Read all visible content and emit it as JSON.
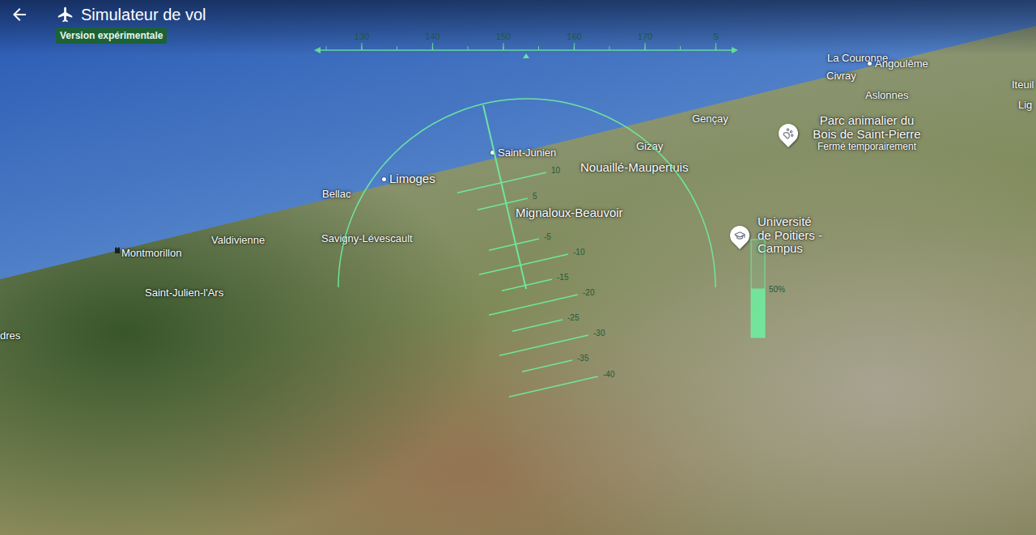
{
  "header": {
    "title": "Simulateur de vol",
    "badge": "Version expérimentale"
  },
  "heading_tape": {
    "labels": [
      "130",
      "140",
      "150",
      "160",
      "170",
      "S"
    ]
  },
  "pitch_ladder": {
    "labels": [
      "10",
      "5",
      "-5",
      "-10",
      "-15",
      "-20",
      "-25",
      "-30",
      "-35",
      "-40"
    ]
  },
  "throttle": {
    "reading": "50%",
    "level": 0.5
  },
  "places": [
    {
      "name": "La Couronne",
      "kind": "plain"
    },
    {
      "name": "Angoulême",
      "kind": "dot"
    },
    {
      "name": "Civray",
      "kind": "plain"
    },
    {
      "name": "Aslonnes",
      "kind": "plain"
    },
    {
      "name": "Iteuil",
      "kind": "plain"
    },
    {
      "name": "Lig",
      "kind": "plain"
    },
    {
      "name": "Gençay",
      "kind": "plain"
    },
    {
      "name": "Parc animalier du Bois de Saint-Pierre",
      "subtitle": "Fermé temporairement",
      "kind": "park"
    },
    {
      "name": "Gizay",
      "kind": "plain"
    },
    {
      "name": "Saint-Junien",
      "kind": "dot"
    },
    {
      "name": "Nouaillé-Maupertuis",
      "kind": "major"
    },
    {
      "name": "Limoges",
      "kind": "city"
    },
    {
      "name": "Bellac",
      "kind": "plain"
    },
    {
      "name": "Mignaloux-Beauvoir",
      "kind": "major"
    },
    {
      "name": "Université de Poitiers - Campus",
      "kind": "campus"
    },
    {
      "name": "Savigny-Lévescault",
      "kind": "plain"
    },
    {
      "name": "Valdivienne",
      "kind": "plain"
    },
    {
      "name": "Montmorillon",
      "kind": "landmark"
    },
    {
      "name": "Saint-Julien-l'Ars",
      "kind": "plain"
    },
    {
      "name": "dres",
      "kind": "plain"
    }
  ]
}
